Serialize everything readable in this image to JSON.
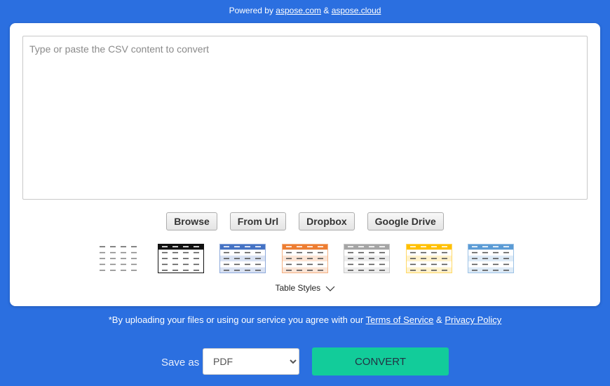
{
  "header": {
    "powered_prefix": "Powered by",
    "link1": "aspose.com",
    "amp": "&",
    "link2": "aspose.cloud"
  },
  "editor": {
    "placeholder": "Type or paste the CSV content to convert"
  },
  "buttons": {
    "browse": "Browse",
    "from_url": "From Url",
    "dropbox": "Dropbox",
    "google_drive": "Google Drive"
  },
  "table_styles": {
    "label": "Table Styles",
    "items": [
      {
        "name": "plain",
        "header": "#777777",
        "stripe": "#ffffff",
        "border": "none"
      },
      {
        "name": "black",
        "header": "#111111",
        "stripe": "#ffffff",
        "border": "#111111"
      },
      {
        "name": "blue",
        "header": "#4472c4",
        "stripe": "#d9e2f3",
        "border": "#8eaadb"
      },
      {
        "name": "orange",
        "header": "#ed7d31",
        "stripe": "#fbe4d5",
        "border": "#f4b183"
      },
      {
        "name": "gray",
        "header": "#a5a5a5",
        "stripe": "#ededed",
        "border": "#c9c9c9"
      },
      {
        "name": "gold",
        "header": "#ffc000",
        "stripe": "#fff2cc",
        "border": "#ffd966"
      },
      {
        "name": "light-blue",
        "header": "#5b9bd5",
        "stripe": "#deebf7",
        "border": "#9dc3e6"
      }
    ]
  },
  "terms": {
    "prefix": "*By uploading your files or using our service you agree with our",
    "tos": "Terms of Service",
    "amp": "&",
    "privacy": "Privacy Policy"
  },
  "footer": {
    "save_as": "Save as",
    "format": "PDF",
    "convert": "CONVERT"
  },
  "colors": {
    "background": "#2b6fe0",
    "convert_button": "#12cc9a"
  }
}
